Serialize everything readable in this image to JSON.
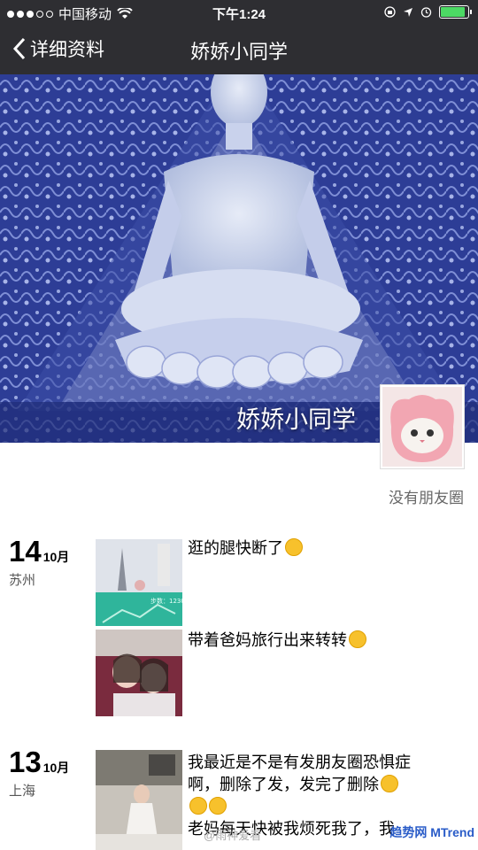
{
  "status": {
    "carrier": "中国移动",
    "time": "下午1:24",
    "battery_level": 0.95
  },
  "nav": {
    "back_label": "详细资料",
    "title": "娇娇小同学"
  },
  "cover": {
    "name": "娇娇小同学"
  },
  "profile": {
    "note": "没有朋友圈"
  },
  "posts": [
    {
      "day": "14",
      "month": "10月",
      "city": "苏州"
    },
    {
      "day": "13",
      "month": "10月",
      "city": "上海"
    }
  ],
  "entries": {
    "e1": "逛的腿快断了",
    "e2": "带着爸妈旅行出来转转",
    "e3_l1": "我最近是不是有发朋友圈恐惧症",
    "e3_l2": "啊，删除了发，发完了删除",
    "e3_l4": "老妈每天快被我烦死我了，我"
  },
  "thumb_text": {
    "steps": "步数：12304"
  },
  "watermark": {
    "weibo": "@雨神爱看",
    "brand": "趋势网 MTrend"
  },
  "colors": {
    "bar": "#2e2e32",
    "cover_blue": "#2c3f9a",
    "accent": "#4cd964"
  }
}
